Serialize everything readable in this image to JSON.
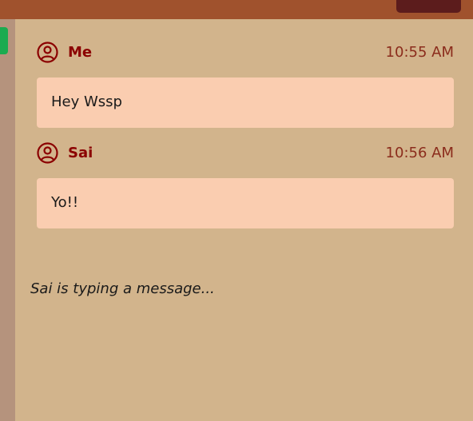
{
  "messages": [
    {
      "sender": "Me",
      "time": "10:55 AM",
      "text": "Hey Wssp"
    },
    {
      "sender": "Sai",
      "time": "10:56 AM",
      "text": "Yo!!"
    }
  ],
  "typing_indicator": "Sai is typing a message...",
  "icons": {
    "avatar": "user-circle-icon"
  },
  "colors": {
    "background": "#d2b48c",
    "top_bar": "#a0522d",
    "top_button": "#5c1c1c",
    "side_rail": "#b5937d",
    "indicator": "#1aab50",
    "bubble": "#facdb0",
    "accent": "#8b0000"
  }
}
